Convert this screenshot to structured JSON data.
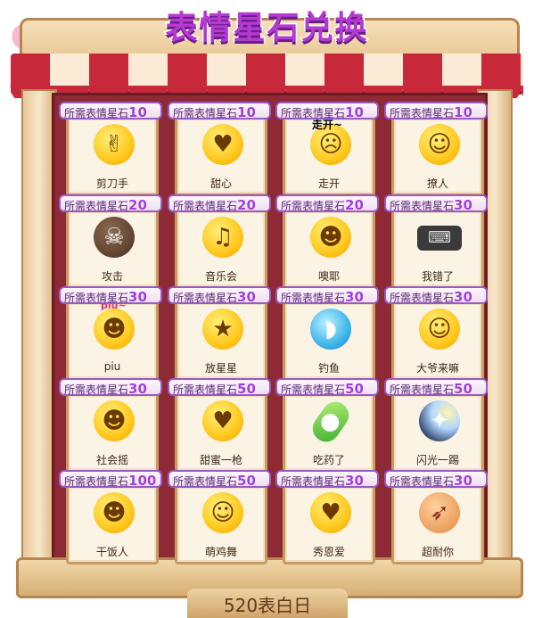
{
  "title": "表情星石兑换",
  "cost_label": "所需表情星石",
  "footer": "520表白日",
  "items": [
    {
      "name": "剪刀手",
      "cost": "10",
      "icon": "scissors-hand-emoji-icon",
      "glyph": "✌"
    },
    {
      "name": "甜心",
      "cost": "10",
      "icon": "heart-hands-emoji-icon",
      "glyph": "♥"
    },
    {
      "name": "走开",
      "cost": "10",
      "icon": "go-away-emoji-icon",
      "glyph": "☹",
      "overlay": "走开~"
    },
    {
      "name": "撩人",
      "cost": "10",
      "icon": "flirt-emoji-icon",
      "glyph": "☺"
    },
    {
      "name": "攻击",
      "cost": "20",
      "icon": "attack-emoji-icon",
      "glyph": "☠"
    },
    {
      "name": "音乐会",
      "cost": "20",
      "icon": "concert-emoji-icon",
      "glyph": "♫"
    },
    {
      "name": "噢耶",
      "cost": "20",
      "icon": "oh-yeah-emoji-icon",
      "glyph": "☻"
    },
    {
      "name": "我错了",
      "cost": "30",
      "icon": "keyboard-icon",
      "glyph": "⌨"
    },
    {
      "name": "piu",
      "cost": "30",
      "icon": "piu-emoji-icon",
      "glyph": "☻",
      "overlay": "piu~"
    },
    {
      "name": "放星星",
      "cost": "30",
      "icon": "star-eyes-emoji-icon",
      "glyph": "★"
    },
    {
      "name": "钓鱼",
      "cost": "30",
      "icon": "dolphin-icon",
      "glyph": "◗"
    },
    {
      "name": "大爷来嘛",
      "cost": "30",
      "icon": "come-here-emoji-icon",
      "glyph": "☺"
    },
    {
      "name": "社会摇",
      "cost": "30",
      "icon": "shake-emoji-icon",
      "glyph": "☻"
    },
    {
      "name": "甜蜜一枪",
      "cost": "50",
      "icon": "sweet-shot-emoji-icon",
      "glyph": "♥"
    },
    {
      "name": "吃药了",
      "cost": "50",
      "icon": "pill-icon",
      "glyph": "●"
    },
    {
      "name": "闪光一踢",
      "cost": "50",
      "icon": "flash-kick-icon",
      "glyph": "✦"
    },
    {
      "name": "干饭人",
      "cost": "100",
      "icon": "rice-eater-emoji-icon",
      "glyph": "☻"
    },
    {
      "name": "萌鸡舞",
      "cost": "50",
      "icon": "chicken-dance-emoji-icon",
      "glyph": "☺"
    },
    {
      "name": "秀恩爱",
      "cost": "30",
      "icon": "show-love-emoji-icon",
      "glyph": "♥"
    },
    {
      "name": "超耐你",
      "cost": "30",
      "icon": "bow-arrow-icon",
      "glyph": "➶"
    }
  ]
}
